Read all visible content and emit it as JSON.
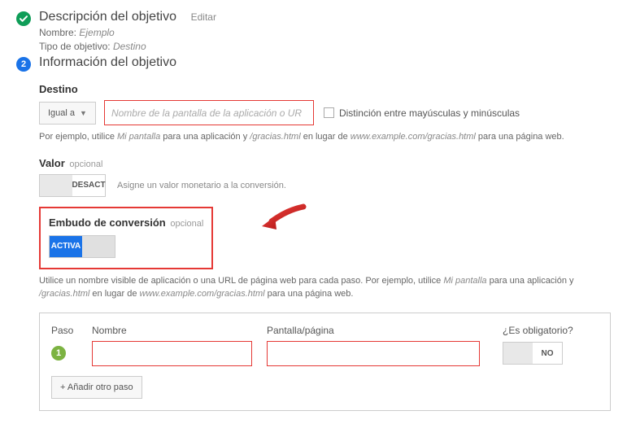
{
  "step1": {
    "title": "Descripción del objetivo",
    "edit": "Editar",
    "name_label": "Nombre:",
    "name_value": "Ejemplo",
    "type_label": "Tipo de objetivo:",
    "type_value": "Destino"
  },
  "step2": {
    "number": "2",
    "title": "Información del objetivo",
    "destino": {
      "label": "Destino",
      "dropdown": "Igual a",
      "placeholder": "Nombre de la pantalla de la aplicación o UR",
      "case_label": "Distinción entre mayúsculas y minúsculas",
      "helper_pre": "Por ejemplo, utilice ",
      "helper_it1": "Mi pantalla",
      "helper_mid1": " para una aplicación y ",
      "helper_it2": "/gracias.html",
      "helper_mid2": " en lugar de ",
      "helper_it3": "www.example.com/gracias.html",
      "helper_post": " para una página web."
    },
    "valor": {
      "label": "Valor",
      "optional": "opcional",
      "toggle_text": "DESACT",
      "desc": "Asigne un valor monetario a la conversión."
    },
    "embudo": {
      "label": "Embudo de conversión",
      "optional": "opcional",
      "toggle_text": "ACTIVA",
      "helper_pre": "Utilice un nombre visible de aplicación o una URL de página web para cada paso. Por ejemplo, utilice ",
      "helper_it1": "Mi pantalla",
      "helper_mid1": " para una aplicación y ",
      "helper_it2": "/gracias.html",
      "helper_mid2": " en lugar de ",
      "helper_it3": "www.example.com/gracias.html",
      "helper_post": " para una página web."
    },
    "steps": {
      "col_paso": "Paso",
      "col_nombre": "Nombre",
      "col_pantalla": "Pantalla/página",
      "col_oblig": "¿Es obligatorio?",
      "step_num": "1",
      "oblig_no": "NO",
      "add_button": "+ Añadir otro paso"
    }
  }
}
